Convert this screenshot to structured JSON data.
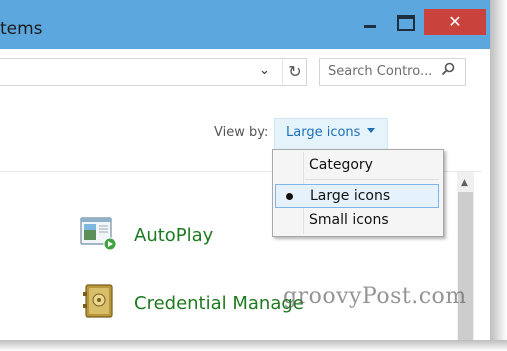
{
  "window": {
    "title_fragment": "tems",
    "minimize_label": "minimize",
    "maximize_label": "maximize",
    "close_label": "✕"
  },
  "address_bar": {
    "chevron": "⌄",
    "refresh": "↻",
    "search_placeholder": "Search Contro..."
  },
  "view_by": {
    "label": "View by:",
    "value": "Large icons"
  },
  "dropdown": {
    "items": [
      {
        "label": "Category",
        "selected": false
      },
      {
        "label": "Large icons",
        "selected": true
      },
      {
        "label": "Small icons",
        "selected": false
      }
    ]
  },
  "items": [
    {
      "label": "AutoPlay",
      "icon": "autoplay-icon"
    },
    {
      "label": "Credential Manage",
      "icon": "credential-manager-icon"
    }
  ],
  "watermark": "groovyPost.com",
  "colors": {
    "titlebar": "#5ca7de",
    "close": "#c9433c",
    "link_green": "#1e7a1e",
    "accent_blue": "#1e71b8"
  }
}
